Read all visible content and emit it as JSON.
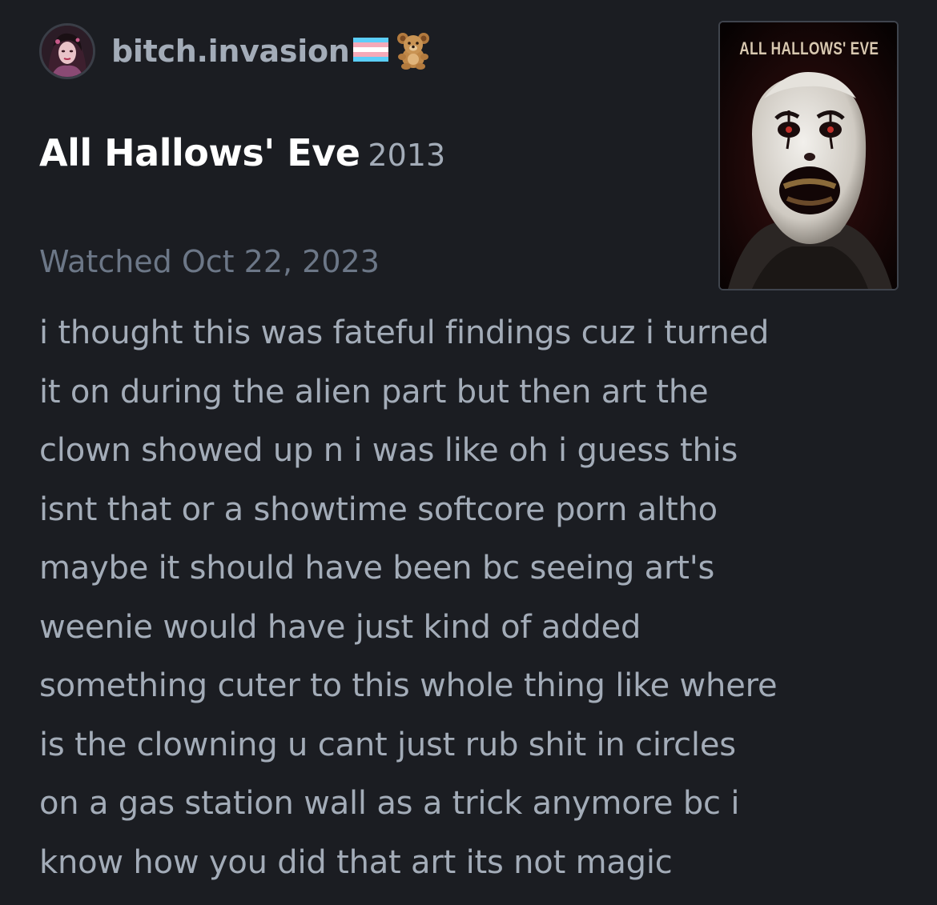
{
  "user": {
    "username": "bitch.invasion",
    "badges": [
      "transgender-flag-icon",
      "teddy-bear-icon"
    ]
  },
  "film": {
    "title": "All Hallows' Eve",
    "year": "2013",
    "poster_title": "ALL HALLOWS' EVE"
  },
  "watched": "Watched Oct 22, 2023",
  "review": {
    "lines": [
      "i thought this was fateful findings cuz i turned",
      "it on during the alien part but then art the",
      "clown showed up n i was like oh i guess this",
      "isnt that or a showtime softcore porn altho",
      "maybe it should have been bc seeing art's",
      "weenie would have just kind of added",
      "something cuter to this whole thing like where",
      "is the clowning u cant just rub shit in circles",
      "on a gas station wall as a trick anymore bc i",
      "know how you did that art its not magic"
    ]
  },
  "colors": {
    "background": "#1b1d22",
    "title": "#ffffff",
    "text": "#a3acb8",
    "muted": "#6c7787"
  }
}
